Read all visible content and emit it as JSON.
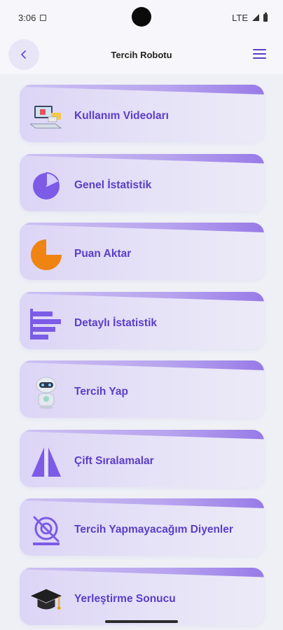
{
  "status": {
    "time": "3:06",
    "network": "LTE"
  },
  "header": {
    "title": "Tercih Robotu",
    "back_icon": "chevron-left-icon",
    "menu_icon": "hamburger-menu-icon"
  },
  "menu": [
    {
      "label": "Kullanım Videoları",
      "icon": "computer-video-icon"
    },
    {
      "label": "Genel İstatistik",
      "icon": "pie-chart-icon"
    },
    {
      "label": "Puan Aktar",
      "icon": "quarter-pie-icon"
    },
    {
      "label": "Detaylı İstatistik",
      "icon": "bar-chart-icon"
    },
    {
      "label": "Tercih Yap",
      "icon": "robot-icon"
    },
    {
      "label": "Çift Sıralamalar",
      "icon": "double-triangle-icon"
    },
    {
      "label": "Tercih Yapmayacağım Diyenler",
      "icon": "no-target-icon"
    },
    {
      "label": "Yerleştirme Sonucu",
      "icon": "graduation-cap-icon"
    }
  ],
  "colors": {
    "accent": "#5a3ec8",
    "orange": "#ef8413",
    "purple_icon": "#7c5be6"
  }
}
